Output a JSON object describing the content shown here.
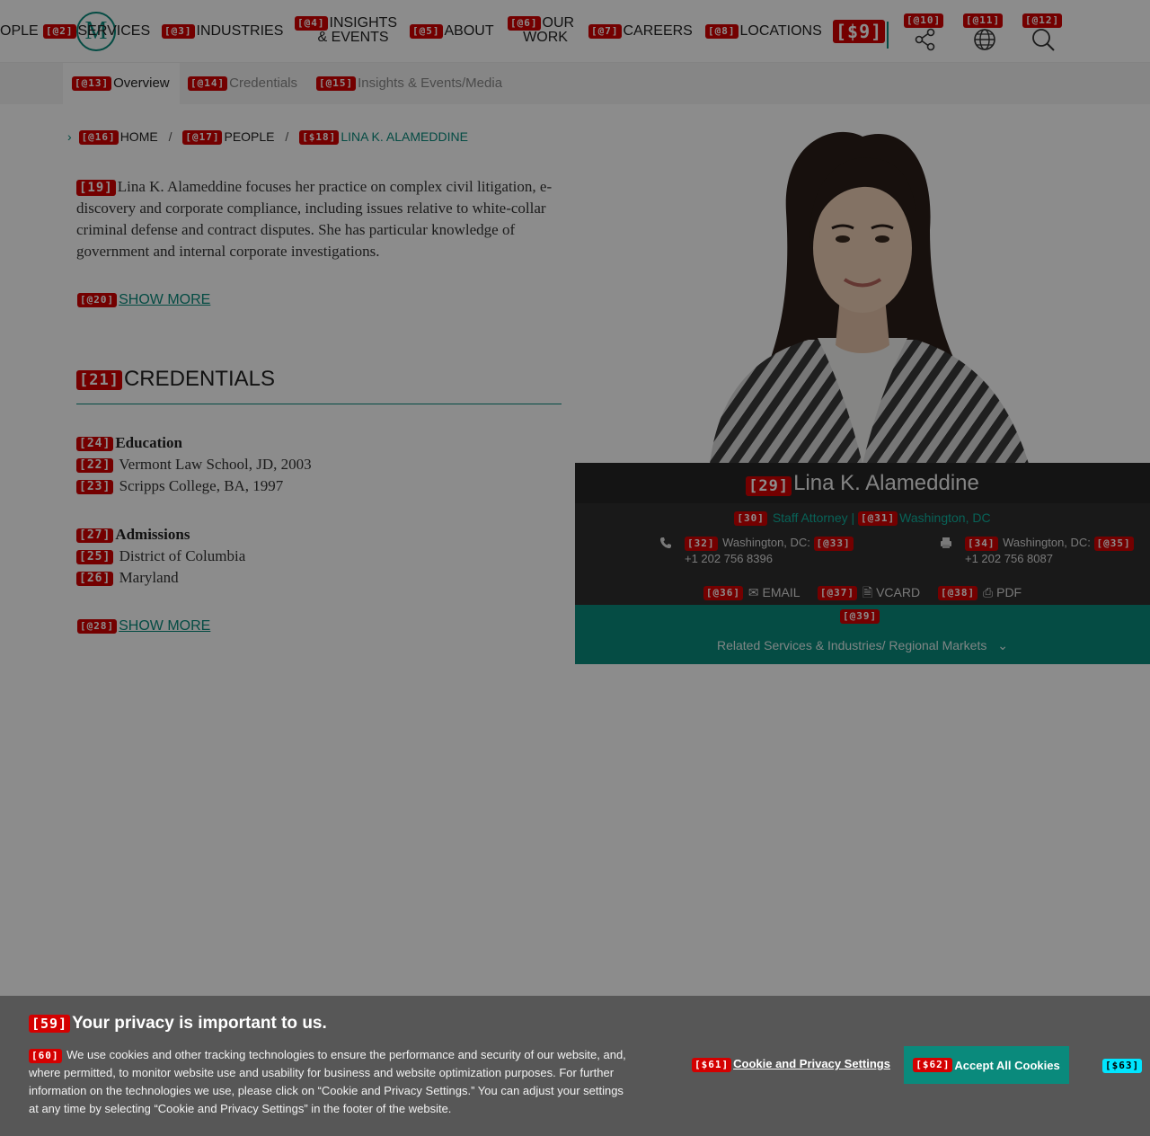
{
  "nav": {
    "items": [
      {
        "tag": "",
        "label": "OPLE"
      },
      {
        "tag": "[@2]",
        "label": "SERVICES"
      },
      {
        "tag": "[@3]",
        "label": "INDUSTRIES"
      },
      {
        "tag": "[@4]",
        "line1": "INSIGHTS",
        "line2": "& EVENTS"
      },
      {
        "tag": "[@5]",
        "label": "ABOUT"
      },
      {
        "tag": "[@6]",
        "line1": "OUR",
        "line2": "WORK"
      },
      {
        "tag": "[@7]",
        "label": "CAREERS"
      },
      {
        "tag": "[@8]",
        "label": "LOCATIONS"
      }
    ],
    "logo_letter": "M",
    "tag9": "[$9]",
    "share_tag": "[@10]",
    "globe_tag": "[@11]",
    "search_tag": "[@12]"
  },
  "subnav": {
    "tabs": [
      {
        "tag": "[@13]",
        "label": "Overview"
      },
      {
        "tag": "[@14]",
        "label": "Credentials"
      },
      {
        "tag": "[@15]",
        "label": "Insights & Events/Media"
      }
    ]
  },
  "breadcrumb": {
    "home_tag": "[@16]",
    "home": "HOME",
    "people_tag": "[@17]",
    "people": "PEOPLE",
    "current_tag": "[$18]",
    "current": "LINA K. ALAMEDDINE",
    "sep": "/"
  },
  "bio": {
    "tag": "[19]",
    "text": "Lina K. Alameddine focuses her practice on complex civil litigation, e-discovery and corporate compliance, including issues relative to white-collar criminal defense and contract disputes. She has particular knowledge of government and internal corporate investigations.",
    "show_more_tag": "[@20]",
    "show_more": "SHOW MORE"
  },
  "credentials": {
    "title_tag": "[21]",
    "title": "CREDENTIALS",
    "education": {
      "tag": "[24]",
      "heading": "Education",
      "items": [
        {
          "tag": "[22]",
          "text": "Vermont Law School, JD, 2003"
        },
        {
          "tag": "[23]",
          "text": "Scripps College, BA, 1997"
        }
      ]
    },
    "admissions": {
      "tag": "[27]",
      "heading": "Admissions",
      "items": [
        {
          "tag": "[25]",
          "text": "District of Columbia"
        },
        {
          "tag": "[26]",
          "text": "Maryland"
        }
      ]
    },
    "show_more_tag": "[@28]",
    "show_more": "SHOW MORE"
  },
  "card": {
    "name_tag": "[29]",
    "name": "Lina K. Alameddine",
    "role_tag": "[30]",
    "role": "Staff Attorney |",
    "office_tag": "[@31]",
    "office": "Washington, DC",
    "phone": {
      "tag": "[32]",
      "label": "Washington, DC:",
      "link_tag": "[@33]",
      "number": "+1 202 756 8396"
    },
    "fax": {
      "tag": "[34]",
      "label": "Washington, DC:",
      "link_tag": "[@35]",
      "number": "+1 202 756 8087"
    },
    "email_tag": "[@36]",
    "email": "EMAIL",
    "vcard_tag": "[@37]",
    "vcard": "VCARD",
    "pdf_tag": "[@38]",
    "pdf": "PDF"
  },
  "related": {
    "tag": "[@39]",
    "label": "Related Services & Industries/ Regional Markets"
  },
  "cookie": {
    "title_tag": "[59]",
    "title": "Your privacy is important to us.",
    "text_tag": "[60]",
    "text": "We use cookies and other tracking technologies to ensure the performance and security of our website, and, where permitted, to monitor website use and usability for business and website optimization purposes. For further information on the technologies we use, please click on “Cookie and Privacy Settings.” You can adjust your settings at any time by selecting “Cookie and Privacy Settings” in the footer of the website.",
    "settings_tag": "[$61]",
    "settings": "Cookie and Privacy Settings",
    "accept_tag": "[$62]",
    "accept": "Accept All Cookies",
    "close_tag": "[$63]"
  },
  "colors": {
    "brand_teal": "#0a8a7c",
    "tag_red": "#d40000",
    "card_dark": "#2e2e2e"
  }
}
